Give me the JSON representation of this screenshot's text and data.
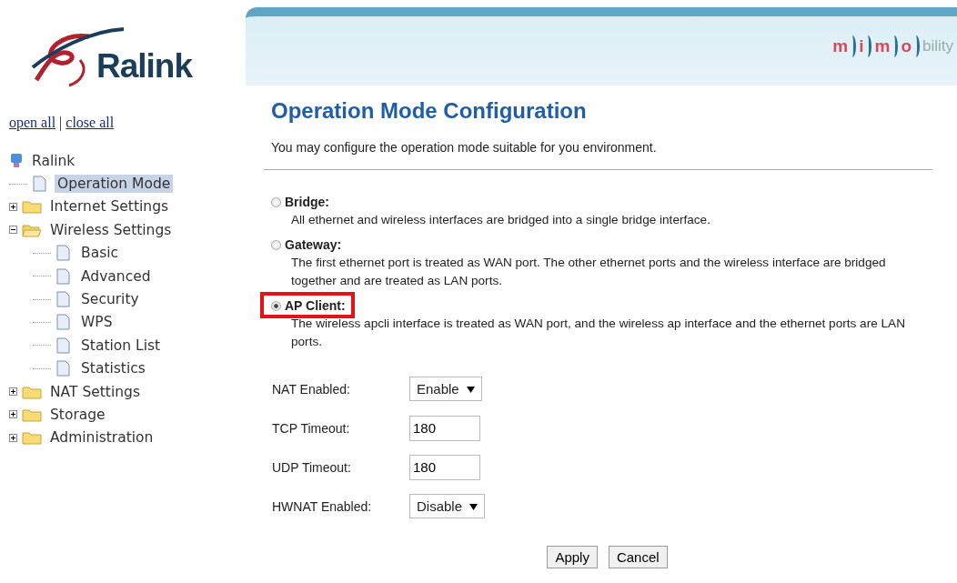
{
  "brand": {
    "name": "Ralink"
  },
  "tree_links": [
    {
      "label": "open all"
    },
    {
      "label": "close all"
    }
  ],
  "tree_separator": "|",
  "tree": {
    "label": "Ralink",
    "children": [
      {
        "label": "Operation Mode",
        "kind": "page",
        "selected": true
      },
      {
        "label": "Internet Settings",
        "kind": "folder",
        "expanded": false,
        "selected": false
      },
      {
        "label": "Wireless Settings",
        "kind": "folder",
        "expanded": true,
        "selected": false,
        "children": [
          {
            "label": "Basic",
            "kind": "page",
            "selected": false
          },
          {
            "label": "Advanced",
            "kind": "page",
            "selected": false
          },
          {
            "label": "Security",
            "kind": "page",
            "selected": false
          },
          {
            "label": "WPS",
            "kind": "page",
            "selected": false
          },
          {
            "label": "Station List",
            "kind": "page",
            "selected": false
          },
          {
            "label": "Statistics",
            "kind": "page",
            "selected": false
          }
        ]
      },
      {
        "label": "NAT Settings",
        "kind": "folder",
        "expanded": false,
        "selected": false
      },
      {
        "label": "Storage",
        "kind": "folder",
        "expanded": false,
        "selected": false
      },
      {
        "label": "Administration",
        "kind": "folder",
        "expanded": false,
        "selected": false
      }
    ]
  },
  "banner": {
    "logo_marks": [
      "m",
      "i",
      "m",
      "o"
    ],
    "logo_tail": "bility"
  },
  "title": "Operation Mode Configuration",
  "description": "You may configure the operation mode suitable for you environment.",
  "modes": [
    {
      "label": "Bridge:",
      "text": "All ethernet and wireless interfaces are bridged into a single bridge interface.",
      "selected": false,
      "highlighted": false
    },
    {
      "label": "Gateway:",
      "text": "The first ethernet port is treated as WAN port. The other ethernet ports and the wireless interface are bridged together and are treated as LAN ports.",
      "selected": false,
      "highlighted": false
    },
    {
      "label": "AP Client:",
      "text": "The wireless apcli interface is treated as WAN port, and the wireless ap interface and the ethernet ports are LAN ports.",
      "selected": true,
      "highlighted": true
    }
  ],
  "fields": [
    {
      "label": "NAT Enabled:",
      "kind": "select",
      "value": "Enable"
    },
    {
      "label": "TCP Timeout:",
      "kind": "text",
      "value": "180"
    },
    {
      "label": "UDP Timeout:",
      "kind": "text",
      "value": "180"
    },
    {
      "label": "HWNAT Enabled:",
      "kind": "select",
      "value": "Disable"
    }
  ],
  "buttons": [
    "Apply",
    "Cancel"
  ]
}
